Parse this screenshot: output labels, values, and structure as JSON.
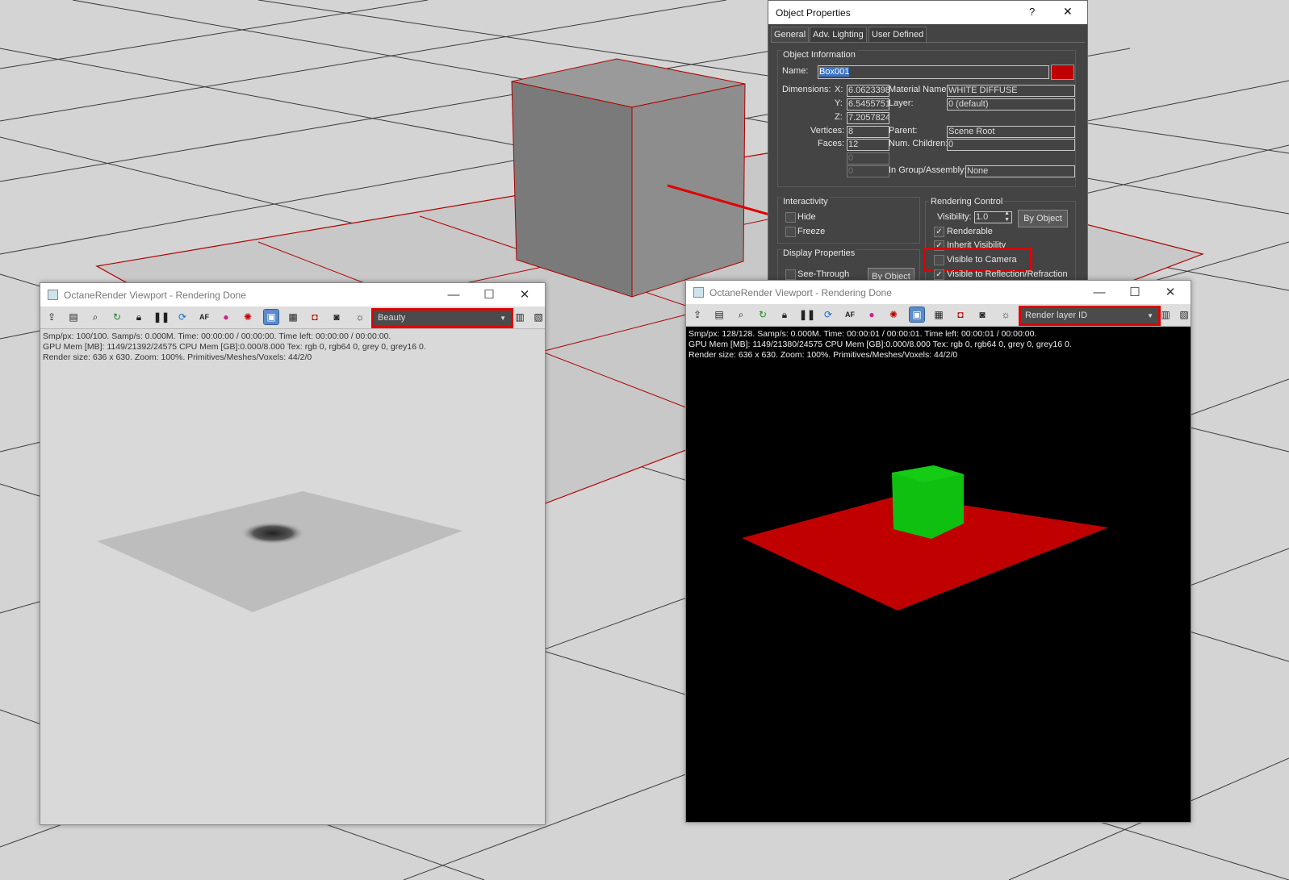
{
  "colors": {
    "scene_bg": "#d4d4d4",
    "selection_red": "#e00000",
    "dialog_bg": "#444444",
    "cube_green": "#10c010",
    "plane_red": "#c00000"
  },
  "object_properties": {
    "title": "Object Properties",
    "help": "?",
    "close": "✕",
    "tabs": [
      "General",
      "Adv. Lighting",
      "User Defined"
    ],
    "object_info_label": "Object Information",
    "name_label": "Name:",
    "name_value": "Box001",
    "color_swatch": "#c00000",
    "dimensions_label": "Dimensions:",
    "x_label": "X:",
    "x_value": "6.0623398",
    "y_label": "Y:",
    "y_value": "6.5455751",
    "z_label": "Z:",
    "z_value": "7.2057824",
    "material_name_label": "Material Name:",
    "material_name_value": "WHITE DIFFUSE",
    "layer_label": "Layer:",
    "layer_value": "0 (default)",
    "vertices_label": "Vertices:",
    "vertices_value": "8",
    "faces_label": "Faces:",
    "faces_value": "12",
    "extra1_value": "0",
    "extra2_value": "0",
    "parent_label": "Parent:",
    "parent_value": "Scene Root",
    "num_children_label": "Num. Children:",
    "num_children_value": "0",
    "in_group_label": "In Group/Assembly:",
    "in_group_value": "None",
    "interactivity_label": "Interactivity",
    "hide_label": "Hide",
    "freeze_label": "Freeze",
    "display_props_label": "Display Properties",
    "see_through_label": "See-Through",
    "by_object_display": "By Object",
    "rendering_control_label": "Rendering Control",
    "visibility_label": "Visibility:",
    "visibility_value": "1.0",
    "by_object_render": "By Object",
    "renderable_label": "Renderable",
    "inherit_visibility_label": "Inherit Visibility",
    "visible_to_camera_label": "Visible to Camera",
    "visible_to_reflection_label": "Visible to Reflection/Refraction",
    "renderable_checked": true,
    "inherit_checked": true,
    "visible_to_camera_checked": false,
    "visible_to_reflection_checked": true
  },
  "viewport_left": {
    "title": "OctaneRender Viewport - Rendering Done",
    "minimize": "—",
    "maximize": "☐",
    "close": "✕",
    "render_pass": "Beauty",
    "info_line1": "Smp/px: 100/100.   Samp/s: 0.000M.   Time: 00:00:00 / 00:00:00.   Time left: 00:00:00 / 00:00:00.",
    "info_line2": "GPU Mem [MB]: 1149/21392/24575   CPU Mem [GB]:0.000/8.000   Tex: rgb 0, rgb64 0, grey 0, grey16 0.",
    "info_line3": "Render size: 636 x 630.   Zoom: 100%.   Primitives/Meshes/Voxels: 44/2/0"
  },
  "viewport_right": {
    "title": "OctaneRender Viewport - Rendering Done",
    "minimize": "—",
    "maximize": "☐",
    "close": "✕",
    "render_pass": "Render layer ID",
    "info_line1": "Smp/px: 128/128.   Samp/s: 0.000M.   Time: 00:00:01 / 00:00:01.   Time left: 00:00:01 / 00:00:00.",
    "info_line2": "GPU Mem [MB]: 1149/21380/24575   CPU Mem [GB]:0.000/8.000   Tex: rgb 0, rgb64 0, grey 0, grey16 0.",
    "info_line3": "Render size: 636 x 630.   Zoom: 100%.   Primitives/Meshes/Voxels: 44/2/0"
  },
  "toolbar_icons": [
    "import-icon",
    "clipboard-icon",
    "zoom-region-icon",
    "restart-render-icon",
    "lock-icon",
    "pause-icon",
    "refresh-icon",
    "autofocus-icon",
    "color-picker-icon",
    "settings-reset-icon",
    "display-icon",
    "film-icon",
    "region-render-icon",
    "camera-icon",
    "sun-icon",
    "table-icon",
    "save-icon"
  ]
}
